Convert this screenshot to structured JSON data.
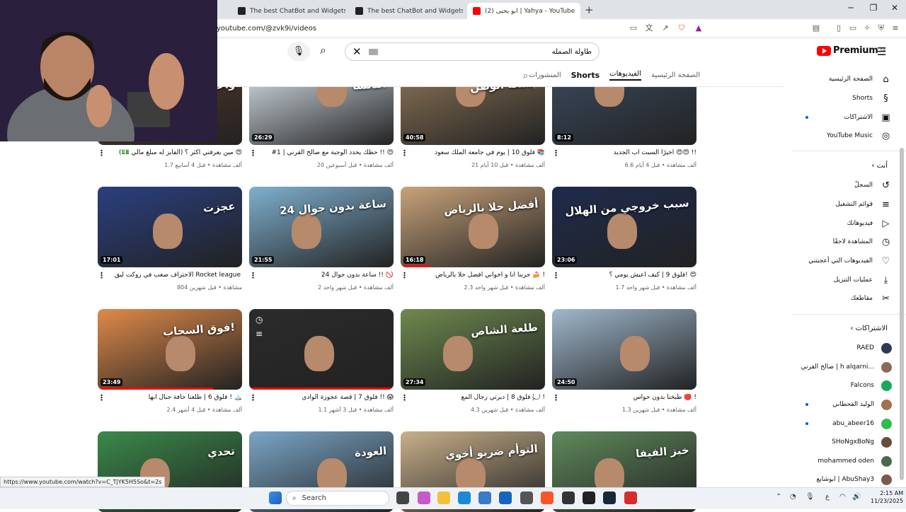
{
  "browser": {
    "tabs": [
      {
        "title": "The best ChatBot and Widgets for Ki",
        "favicon_color": "#222222"
      },
      {
        "title": "The best ChatBot and Widgets for Ki",
        "favicon_color": "#222222"
      },
      {
        "title": "ابو يحيى (2) | Yahya - YouTube",
        "favicon_color": "#ff0000"
      }
    ],
    "url": "youtube.com/@zvk9i/videos"
  },
  "header": {
    "search_value": "طاولة الصمله",
    "logo_text": "Premium",
    "logo_region": "SA"
  },
  "channel_tabs": [
    "الصفحة الرئيسية",
    "الفيديوهات",
    "Shorts",
    "المنشورات"
  ],
  "videos": [
    {
      "title": "اخيرًا السيت اب الجديد 😍😍 !!",
      "views": "6.6 ألف مشاهدة",
      "age": "قبل 4 أيام",
      "duration": "8:12",
      "overlay": "",
      "color": "#3b4a60",
      "progress": 0
    },
    {
      "title": "فلوق 10 | يوم في جامعة الملك سعود 📚",
      "views": "21 ألف مشاهدة",
      "age": "قبل 10 أيام",
      "duration": "40:58",
      "overlay": "جامعة الوطن",
      "color": "#8c7456",
      "progress": 0
    },
    {
      "title": "#1 | حظك يحدد الوجبة مع صالح القرني !! 😍",
      "views": "20 ألف مشاهدة",
      "age": "قبل أسبوعين",
      "duration": "26:29",
      "overlay": "ماتشا!",
      "color": "#d9e3ea",
      "progress": 0
    },
    {
      "title": "مين يعرفني اكثر ؟ (الفايز له مبلغ مالي 💵) 😍",
      "views": "1.7 ألف مشاهدة",
      "age": "قبل 4 أسابيع",
      "duration": "",
      "overlay": "واحد",
      "color": "#5a3a2a",
      "progress": 0
    },
    {
      "title": "فلوق 9 | كيف أعيش يومي ؟! 😍",
      "views": "1.7 ألف مشاهدة",
      "age": "قبل شهر واحد",
      "duration": "23:06",
      "overlay": "سبب خروجي من الهلال",
      "color": "#1e2b4d",
      "progress": 0
    },
    {
      "title": "جربنا انا و أخواني افضل حلا بالرياض 🍰 !",
      "views": "2.3 ألف مشاهدة",
      "age": "قبل شهر واحد",
      "duration": "16:18",
      "overlay": "أفضل حلا بالرياض",
      "color": "#c9a37a",
      "progress": 0.2
    },
    {
      "title": "24 ساعة بدون جوال !! 🚫",
      "views": "2 ألف مشاهدة",
      "age": "قبل شهر واحد",
      "duration": "21:55",
      "overlay": "24 ساعة بدون جوال",
      "color": "#7fb0cf",
      "progress": 0
    },
    {
      "title": "الاحتراف صعب في روكت ليق Rocket league !",
      "views": "804 مشاهدة",
      "age": "قبل شهرين",
      "duration": "17:01",
      "overlay": "عجزت",
      "color": "#2a3f80",
      "progress": 0
    },
    {
      "title": "طبخنا بدون حواس 🔴 !",
      "views": "1.3 ألف مشاهدة",
      "age": "قبل شهرين",
      "duration": "24:50",
      "overlay": "",
      "color": "#9fb8cc",
      "progress": 0
    },
    {
      "title": "فلوق 8 | ديرتي رجال ألمع 💭 !",
      "views": "4.3 ألف مشاهدة",
      "age": "قبل شهرين",
      "duration": "27:34",
      "overlay": "طلعة الشاص",
      "color": "#6e8a4e",
      "progress": 0
    },
    {
      "title": "فلوق 7 | قصة عجوزة الوادي !! 😱",
      "views": "1.1 ألف مشاهدة",
      "age": "قبل 3 أشهر",
      "duration": "",
      "overlay": "",
      "color": "#2b2b2b",
      "progress": 1
    },
    {
      "title": "فلوق 6 | طلعنا حافة جبال ابها ! 🏔️",
      "views": "2.4 ألف مشاهدة",
      "age": "قبل 4 أشهر",
      "duration": "23:49",
      "overlay": "فوق السحاب!",
      "color": "#e08a4a",
      "progress": 0.8
    },
    {
      "title": "",
      "views": "",
      "age": "",
      "duration": "",
      "overlay": "خبز الفيفا",
      "color": "#5f8a5c",
      "progress": 0
    },
    {
      "title": "",
      "views": "",
      "age": "",
      "duration": "",
      "overlay": "التوأم ضربو أخوي",
      "color": "#c9b08a",
      "progress": 0
    },
    {
      "title": "",
      "views": "",
      "age": "",
      "duration": "",
      "overlay": "العودة",
      "color": "#7aa6c8",
      "progress": 0
    },
    {
      "title": "",
      "views": "",
      "age": "",
      "duration": "",
      "overlay": "تحدي",
      "color": "#3a8a4a",
      "progress": 0
    }
  ],
  "sidebar": {
    "main": [
      {
        "label": "الصفحة الرئيسية",
        "icon": "home-icon",
        "glyph": "⌂"
      },
      {
        "label": "Shorts",
        "icon": "shorts-icon",
        "glyph": "§"
      },
      {
        "label": "الاشتراكات",
        "icon": "subscriptions-icon",
        "glyph": "▣"
      },
      {
        "label": "YouTube Music",
        "icon": "music-icon",
        "glyph": "◎"
      }
    ],
    "you_label": "أنت",
    "you": [
      {
        "label": "السجلّ",
        "icon": "history-icon",
        "glyph": "↺"
      },
      {
        "label": "قوائم التشغيل",
        "icon": "playlists-icon",
        "glyph": "≡"
      },
      {
        "label": "فيديوهاتك",
        "icon": "your-videos-icon",
        "glyph": "▷"
      },
      {
        "label": "المشاهدة لاحقًا",
        "icon": "watch-later-icon",
        "glyph": "◷"
      },
      {
        "label": "الفيديوهات التي أعجبتني",
        "icon": "liked-icon",
        "glyph": "♡"
      },
      {
        "label": "عمليات التنزيل",
        "icon": "download-icon",
        "glyph": "⤓"
      },
      {
        "label": "مقاطعك",
        "icon": "clips-icon",
        "glyph": "✂"
      }
    ],
    "subs_label": "الاشتراكات",
    "subs": [
      {
        "label": "RAED",
        "color": "#2b3a55",
        "dot": false
      },
      {
        "label": "صالح القرني | h alqarni...",
        "color": "#8a6a5a",
        "dot": false
      },
      {
        "label": "Falcons",
        "color": "#1aa85a",
        "dot": false
      },
      {
        "label": "الوليد القحطاني",
        "color": "#a07050",
        "dot": true
      },
      {
        "label": "abu_abeer16",
        "color": "#2dbd4e",
        "dot": true
      },
      {
        "label": "SHoNgxBoNg",
        "color": "#6b4a3a",
        "dot": false
      },
      {
        "label": "mohammed oden",
        "color": "#4a6a4a",
        "dot": false
      },
      {
        "label": "ابوشايع | AbuShay3",
        "color": "#7a5a4a",
        "dot": false
      }
    ]
  },
  "status_url": "https://www.youtube.com/watch?v=C_TjYK5H5So&t=2s",
  "taskbar": {
    "search_placeholder": "Search",
    "time": "2:15 AM",
    "date": "11/23/2025",
    "lang": "ع"
  }
}
